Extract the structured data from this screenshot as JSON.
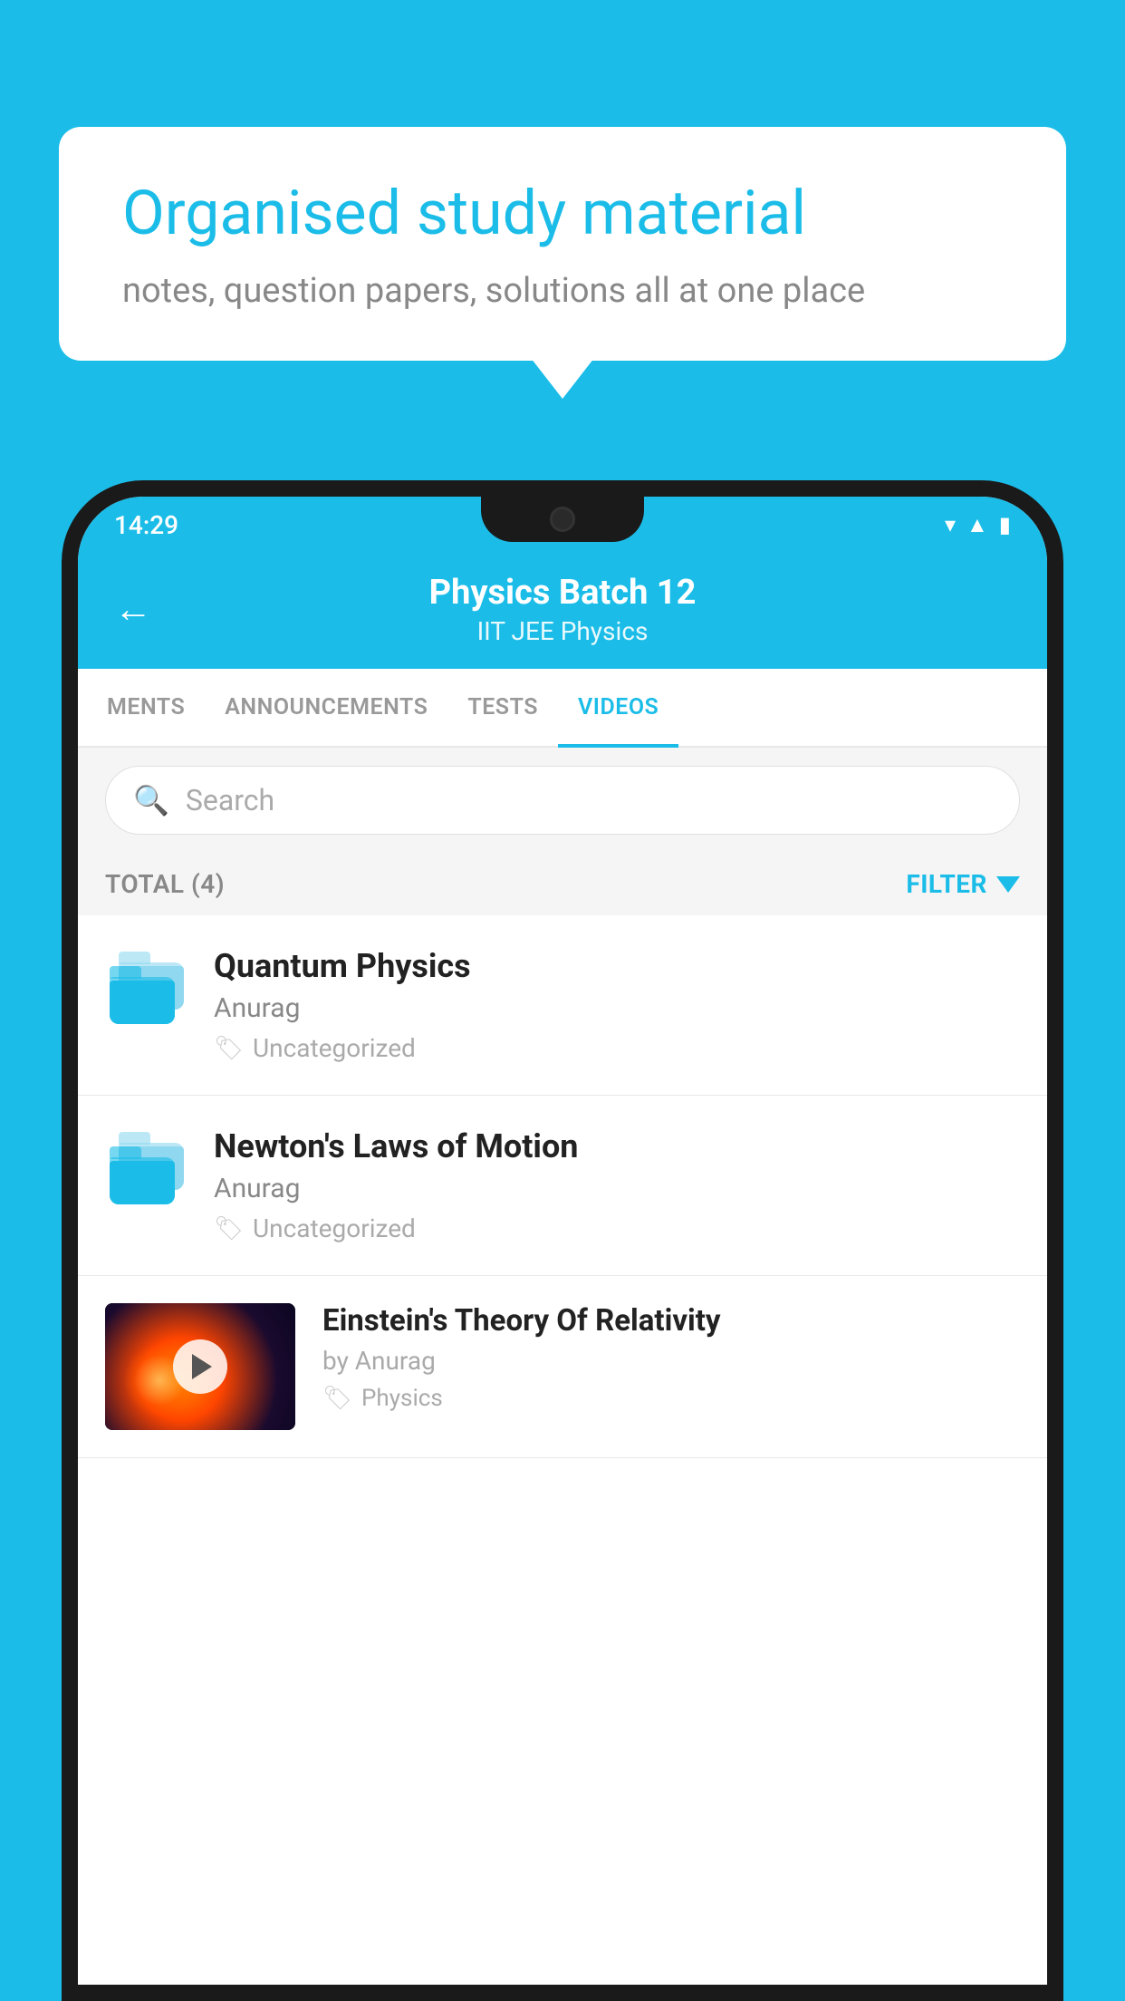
{
  "background_color": "#1BBDE8",
  "speech_bubble": {
    "title": "Organised study material",
    "subtitle": "notes, question papers, solutions all at one place"
  },
  "phone": {
    "status_bar": {
      "time": "14:29",
      "icons": [
        "wifi",
        "signal",
        "battery"
      ]
    },
    "header": {
      "back_label": "←",
      "title": "Physics Batch 12",
      "subtitle": "IIT JEE   Physics"
    },
    "tabs": [
      {
        "label": "MENTS",
        "active": false
      },
      {
        "label": "ANNOUNCEMENTS",
        "active": false
      },
      {
        "label": "TESTS",
        "active": false
      },
      {
        "label": "VIDEOS",
        "active": true
      }
    ],
    "search": {
      "placeholder": "Search"
    },
    "filter_row": {
      "total_label": "TOTAL (4)",
      "filter_label": "FILTER"
    },
    "videos": [
      {
        "title": "Quantum Physics",
        "author": "Anurag",
        "tag": "Uncategorized",
        "has_thumbnail": false
      },
      {
        "title": "Newton's Laws of Motion",
        "author": "Anurag",
        "tag": "Uncategorized",
        "has_thumbnail": false
      },
      {
        "title": "Einstein's Theory Of Relativity",
        "author": "by Anurag",
        "tag": "Physics",
        "has_thumbnail": true
      }
    ]
  }
}
